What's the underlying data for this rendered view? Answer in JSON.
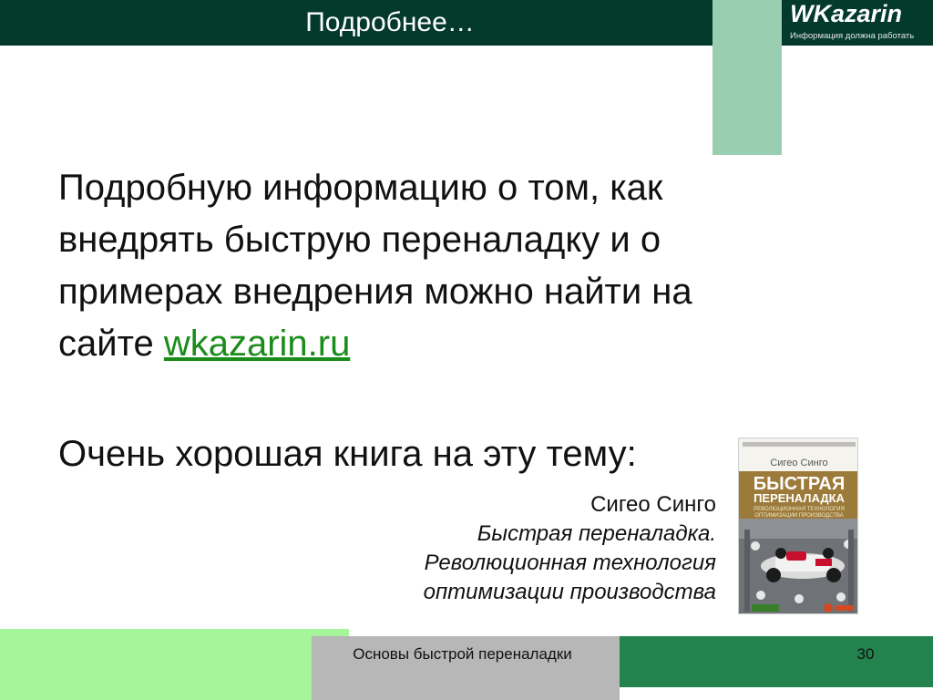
{
  "header": {
    "title": "Подробнее…"
  },
  "logo": {
    "name": "WKazarin",
    "tagline": "Информация должна работать"
  },
  "main": {
    "paragraph_before_link": "Подробную информацию о том, как внедрять быструю переналадку и о примерах внедрения можно найти на сайте ",
    "link_text": "wkazarin.ru"
  },
  "book": {
    "heading": "Очень хорошая книга на эту тему:",
    "author": "Сигео Синго",
    "title_line1": "Быстрая переналадка.",
    "title_line2": "Революционная технология",
    "title_line3": "оптимизации производства",
    "cover": {
      "author": "Сигео Синго",
      "title_line1": "БЫСТРАЯ",
      "title_line2": "ПЕРЕНАЛАДКА",
      "subtitle_line1": "РЕВОЛЮЦИОННАЯ ТЕХНОЛОГИЯ",
      "subtitle_line2": "ОПТИМИЗАЦИИ ПРОИЗВОДСТВА"
    }
  },
  "footer": {
    "text": "Основы быстрой переналадки",
    "page_number": "30"
  },
  "colors": {
    "dark_green": "#033a2c",
    "light_green": "#99cfb0",
    "link_green": "#1a8c1a",
    "bottom_light_green": "#a6f59a",
    "bottom_dark_green": "#23834f",
    "gray": "#b7b7b7"
  }
}
